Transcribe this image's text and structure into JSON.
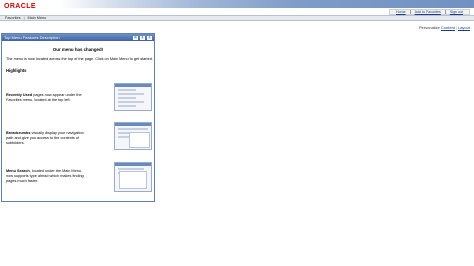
{
  "header": {
    "logo": "ORACLE",
    "links": [
      "Home",
      "Add to Favorites",
      "Sign out"
    ]
  },
  "menubar": {
    "items": [
      "Favorites",
      "Main Menu"
    ]
  },
  "personalize": {
    "label": "Personalize",
    "content": "Content",
    "layout": "Layout"
  },
  "pagelet": {
    "title": "Top Menu Features Description",
    "headline": "Our menu has changed!",
    "intro": "The menu is now located across the top of the page. Click on Main Menu to get started.",
    "highlights": "Highlights",
    "features": [
      {
        "title": "Recently Used",
        "text": "pages now appear under the Favorites menu, located at the top left."
      },
      {
        "title": "Breadcrumbs",
        "text": "visually display your navigation path and give you access to the contents of subfolders."
      },
      {
        "title": "Menu Search",
        "text": ", located under the Main Menu, now supports type ahead which makes finding pages much faster."
      }
    ]
  },
  "colors": {
    "logo": "#d10000",
    "pagelet_header": "#3f63a5",
    "link": "#1a3d8f"
  }
}
